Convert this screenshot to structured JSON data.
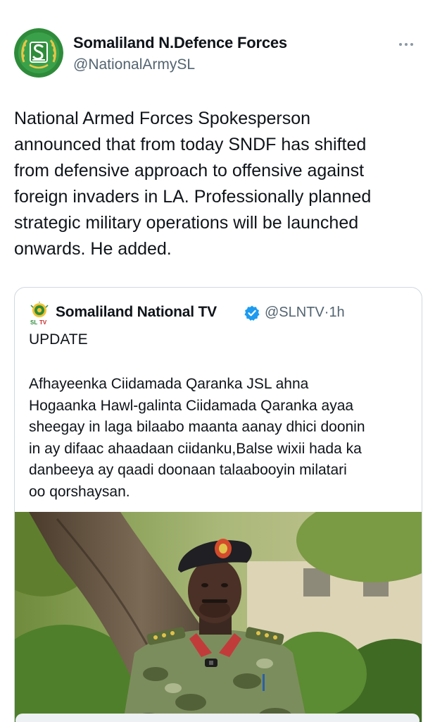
{
  "tweet": {
    "author_name": "Somaliland N.Defence Forces",
    "author_handle": "@NationalArmySL",
    "more_icon": "more-horizontal-icon",
    "text_lines": [
      "National Armed Forces Spokesperson",
      "announced that from today SNDF has shifted",
      "from defensive approach to offensive against",
      "foreign invaders in LA.  Professionally planned",
      "strategic military operations will be launched",
      "onwards. He added."
    ]
  },
  "quote": {
    "author_name": "Somaliland National TV",
    "verified_icon": "verified-badge-icon",
    "author_handle": "@SLNTV",
    "separator": "·",
    "time": "1h",
    "update_label": "UPDATE",
    "body_lines": [
      "Afhayeenka Ciidamada Qaranka JSL ahna",
      "Hogaanka Hawl-galinta Ciidamada Qaranka ayaa",
      "sheegay in laga bilaabo maanta aanay dhici doonin",
      "in ay difaac ahaadaan ciidanku,Balse wixii hada ka",
      "danbeeya ay qaadi doonaan talaabooyin milatari",
      "oo qorshaysan."
    ],
    "media": "photo-of-uniformed-officer"
  },
  "colors": {
    "text": "#0f1419",
    "secondary": "#536471",
    "border": "#cfd9de",
    "verified": "#1d9bf0",
    "avatar_green": "#2e7d32"
  }
}
